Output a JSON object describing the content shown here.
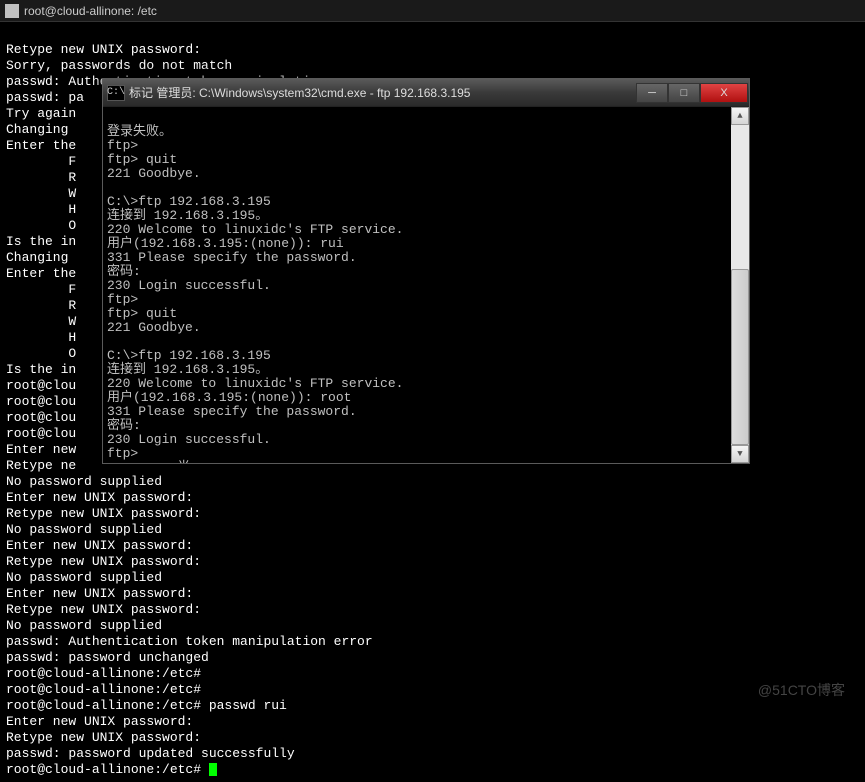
{
  "putty": {
    "title": "root@cloud-allinone: /etc",
    "lines": [
      "Retype new UNIX password:",
      "Sorry, passwords do not match",
      "passwd: Authentication token manipulation error",
      "passwd: pa",
      "Try again",
      "Changing ",
      "Enter the",
      "        F",
      "        R",
      "        W",
      "        H",
      "        O",
      "Is the in",
      "Changing ",
      "Enter the",
      "        F",
      "        R",
      "        W",
      "        H",
      "        O",
      "Is the in",
      "root@clou",
      "root@clou",
      "root@clou",
      "root@clou",
      "Enter new",
      "Retype ne",
      "No password supplied",
      "Enter new UNIX password:",
      "Retype new UNIX password:",
      "No password supplied",
      "Enter new UNIX password:",
      "Retype new UNIX password:",
      "No password supplied",
      "Enter new UNIX password:",
      "Retype new UNIX password:",
      "No password supplied",
      "passwd: Authentication token manipulation error",
      "passwd: password unchanged",
      "root@cloud-allinone:/etc#",
      "root@cloud-allinone:/etc#",
      "root@cloud-allinone:/etc# passwd rui",
      "Enter new UNIX password:",
      "Retype new UNIX password:",
      "passwd: password updated successfully",
      "root@cloud-allinone:/etc# "
    ]
  },
  "cmd": {
    "title": "标记 管理员: C:\\Windows\\system32\\cmd.exe - ftp  192.168.3.195",
    "lines": [
      "登录失败。",
      "ftp>",
      "ftp> quit",
      "221 Goodbye.",
      "",
      "C:\\>ftp 192.168.3.195",
      "连接到 192.168.3.195。",
      "220 Welcome to linuxidc's FTP service.",
      "用户(192.168.3.195:(none)): rui",
      "331 Please specify the password.",
      "密码:",
      "230 Login successful.",
      "ftp>",
      "ftp> quit",
      "221 Goodbye.",
      "",
      "C:\\>ftp 192.168.3.195",
      "连接到 192.168.3.195。",
      "220 Welcome to linuxidc's FTP service.",
      "用户(192.168.3.195:(none)): root",
      "331 Please specify the password.",
      "密码:",
      "230 Login successful.",
      "ftp>",
      "         半:"
    ]
  },
  "buttons": {
    "minimize": "─",
    "maximize": "□",
    "close": "X"
  },
  "scroll": {
    "up": "▲",
    "down": "▼"
  },
  "watermark": "@51CTO博客"
}
